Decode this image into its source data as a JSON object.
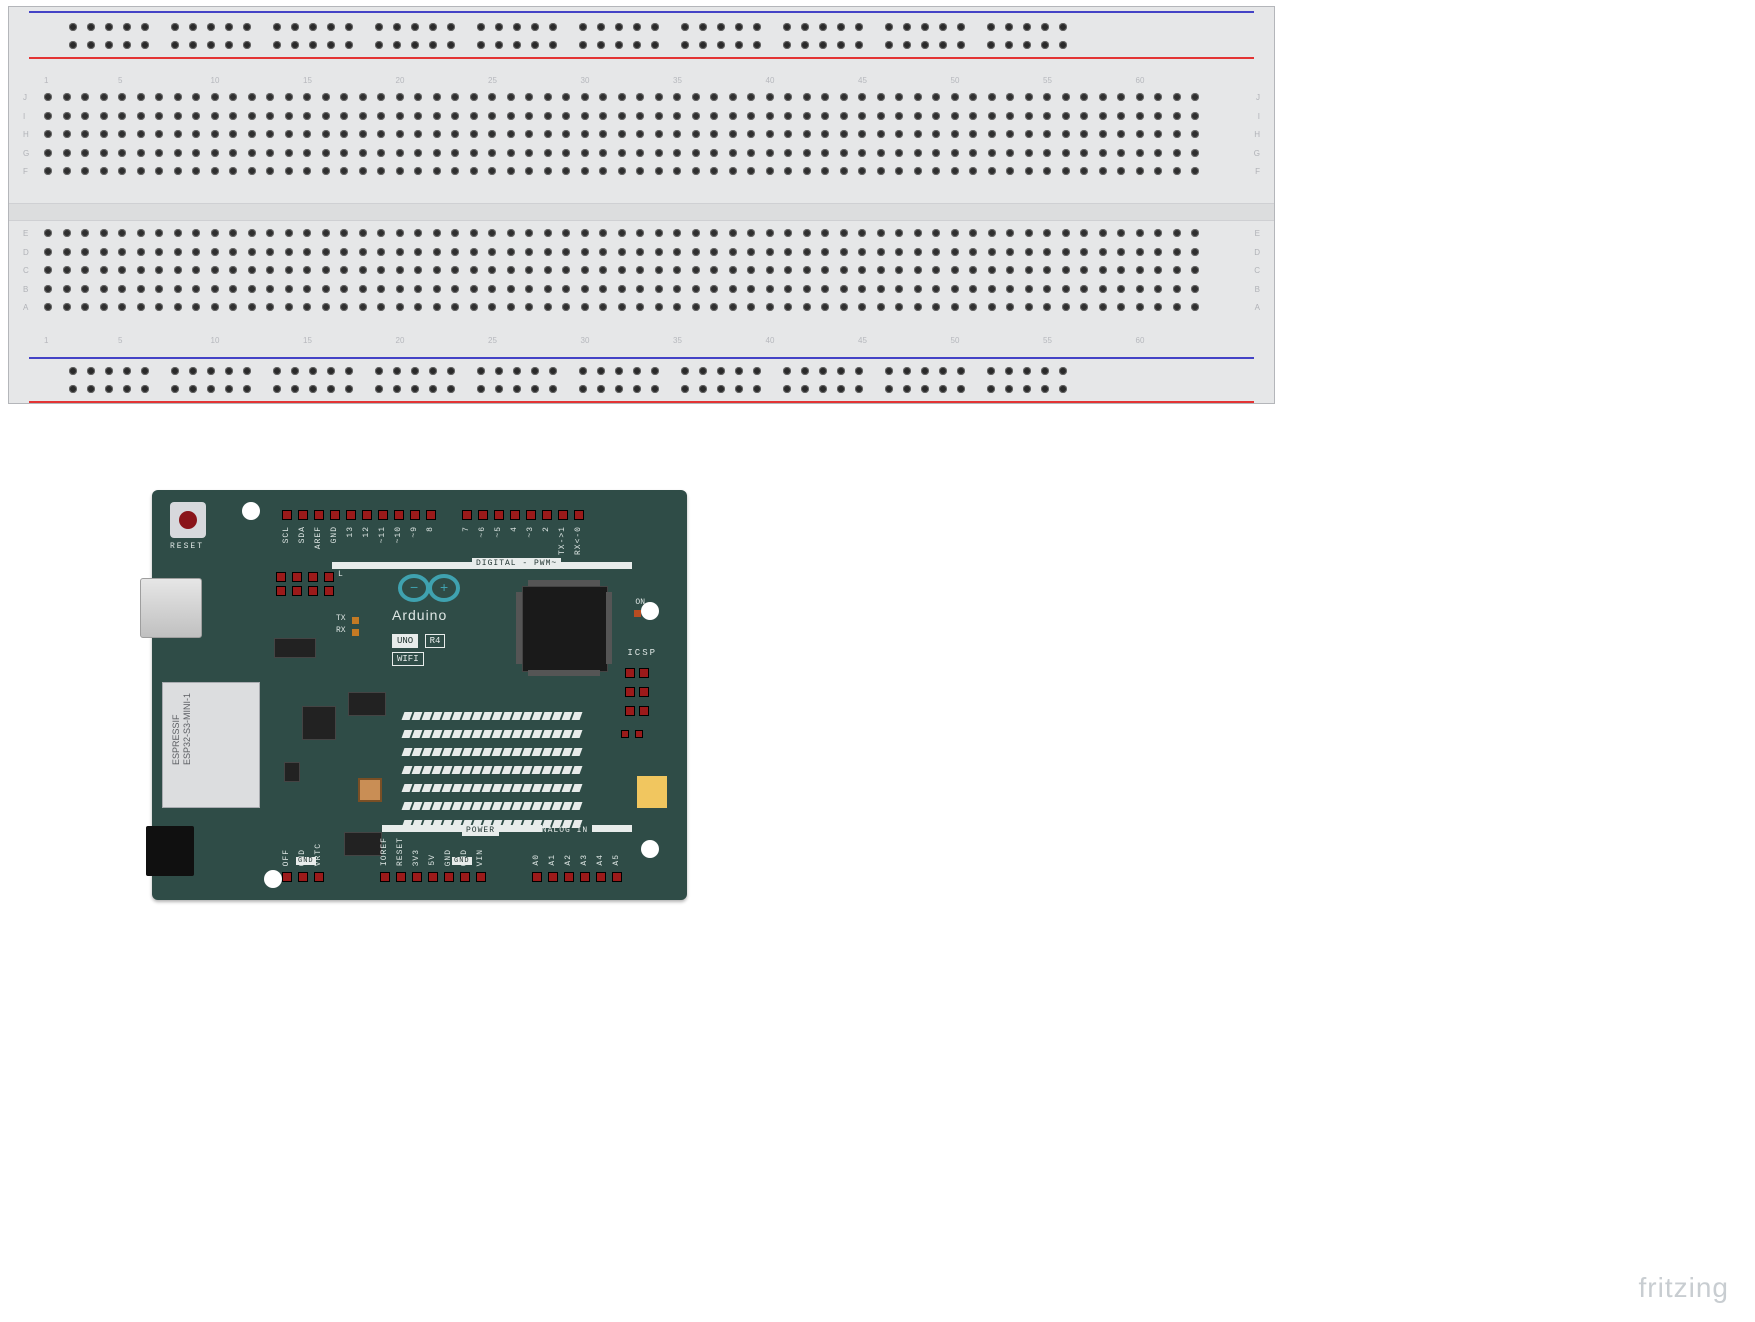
{
  "breadboard": {
    "col_numbers": [
      "1",
      "5",
      "10",
      "15",
      "20",
      "25",
      "30",
      "35",
      "40",
      "45",
      "50",
      "55",
      "60"
    ],
    "row_labels_upper": [
      "J",
      "I",
      "H",
      "G",
      "F"
    ],
    "row_labels_lower": [
      "E",
      "D",
      "C",
      "B",
      "A"
    ]
  },
  "arduino": {
    "reset_label": "RESET",
    "brand": "Arduino",
    "model_badge_1": "UNO",
    "model_badge_2": "R4",
    "model_badge_3": "WIFI",
    "esp_line1": "ESPRESSIF",
    "esp_line2": "ESP32-S3-MINI-1",
    "section_digital": "DIGITAL - PWM~",
    "section_power": "POWER",
    "section_analog": "ANALOG IN",
    "icsp_label": "ICSP",
    "on_label": "ON",
    "tx_label": "TX",
    "rx_label": "RX",
    "l_label": "L",
    "logo_minus": "−",
    "logo_plus": "+",
    "pins_digital_upper": [
      "SCL",
      "SDA",
      "AREF",
      "GND",
      "13",
      "12",
      "~11",
      "~10",
      "~9",
      "8"
    ],
    "pins_digital_upper2": [
      "7",
      "~6",
      "~5",
      "4",
      "~3",
      "2",
      "TX->1",
      "RX<-0"
    ],
    "pins_off_row": [
      "OFF",
      "GND",
      "VRTC"
    ],
    "pins_power_row": [
      "IOREF",
      "RESET",
      "3V3",
      "5V",
      "GND",
      "GND",
      "VIN"
    ],
    "pins_analog_row": [
      "A0",
      "A1",
      "A2",
      "A3",
      "A4",
      "A5"
    ],
    "gnd_highlight": "GND"
  },
  "watermark": "fritzing"
}
